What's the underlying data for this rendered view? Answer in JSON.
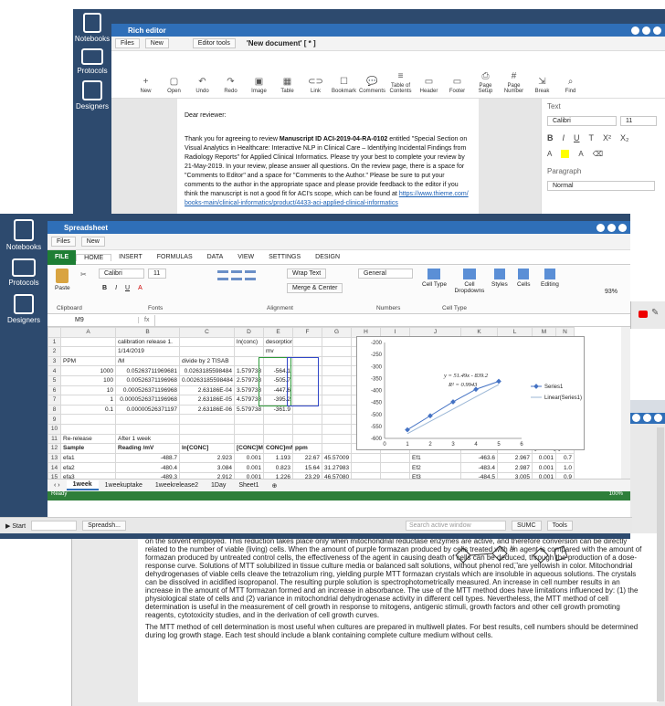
{
  "left_sidebar": {
    "items": [
      {
        "label": "Notebooks",
        "icon": "notebook-icon"
      },
      {
        "label": "Protocols",
        "icon": "protocols-icon"
      },
      {
        "label": "Designers",
        "icon": "designers-icon"
      }
    ]
  },
  "rich_editor": {
    "title": "Rich editor",
    "menu": {
      "files": "Files",
      "new": "New",
      "editor_tools": "Editor tools",
      "doc_name": "'New document' [ * ]"
    },
    "toolbar": [
      "New",
      "Open",
      "Undo",
      "Redo",
      "Image",
      "Table",
      "Link",
      "Bookmark",
      "Comments",
      "Table of Contents",
      "Header",
      "Footer",
      "Page Setup",
      "Page Number",
      "Break",
      "Find"
    ],
    "panel": {
      "text_label": "Text",
      "font": "Calibri",
      "size": "11",
      "paragraph_label": "Paragraph",
      "style": "Normal"
    },
    "document": {
      "greeting": "Dear reviewer:",
      "body_pre": "Thank you for agreeing to review ",
      "manuscript": "Manuscript ID ACI-2019-04-RA-0102",
      "body_post": " entitled \"Special Section on Visual Analytics in Healthcare: Interactive NLP in Clinical Care – Identifying Incidental Findings from Radiology Reports\" for Applied Clinical Informatics. Please try your best to complete your review by 21-May-2019. In your review, please answer all questions. On the review page, there is a space for \"Comments to Editor\" and a space for \"Comments to the Author.\" Please be sure to put your comments to the author in the appropriate space and please provide feedback to the editor if you think the manuscript is not a good fit for ACI's scope, which can be found at",
      "link": "https://www.thieme.com/books-main/clinical-informatics/product/4433-aci-applied-clinical-informatics"
    }
  },
  "spreadsheet": {
    "title": "Spreadsheet",
    "menu": {
      "files": "Files",
      "new": "New"
    },
    "tabs": [
      "FILE",
      "HOME",
      "INSERT",
      "FORMULAS",
      "DATA",
      "VIEW",
      "SETTINGS",
      "DESIGN"
    ],
    "ribbon": {
      "paste": "Paste",
      "font": "Calibri",
      "font_size": "11",
      "wrap_text": "Wrap Text",
      "merge_center": "Merge & Center",
      "number_format": "General",
      "cell_type": "Cell Type",
      "cell_dropdowns": "Cell Dropdowns",
      "styles": "Styles",
      "cells": "Cells",
      "editing": "Editing",
      "groups": [
        "Clipboard",
        "Fonts",
        "Alignment",
        "Numbers",
        "Cell Type"
      ],
      "zoom": "93%"
    },
    "name_box": "M9",
    "columns": [
      "A",
      "B",
      "C",
      "D",
      "E",
      "F",
      "G",
      "H",
      "I",
      "J",
      "K",
      "L",
      "M",
      "N"
    ],
    "rows": [
      {
        "n": "1",
        "cells": [
          "",
          "calibration release 1.",
          "",
          "ln(conc)",
          "desorption",
          "",
          "",
          "",
          "",
          "",
          "",
          "",
          "",
          ""
        ]
      },
      {
        "n": "2",
        "cells": [
          "",
          "1/14/2019",
          "",
          "",
          "mv",
          "",
          "",
          "",
          "",
          "",
          "",
          "",
          "",
          ""
        ]
      },
      {
        "n": "3",
        "cells": [
          "PPM",
          "/M",
          "divide by 2 TISAB",
          "",
          "",
          "",
          "",
          "",
          "",
          "",
          "",
          "",
          "",
          ""
        ]
      },
      {
        "n": "4",
        "cells": [
          "1000",
          "0.05263711969681",
          "0.0263185598484",
          "1.579738",
          "-564.1",
          "",
          "",
          "",
          "",
          "",
          "",
          "",
          "",
          ""
        ]
      },
      {
        "n": "5",
        "cells": [
          "100",
          "0.00526371196968",
          "0.00263185598484",
          "2.579738",
          "-505.7",
          "",
          "",
          "",
          "",
          "",
          "",
          "",
          "",
          ""
        ]
      },
      {
        "n": "6",
        "cells": [
          "10",
          "0.000526371196968",
          "2.63186E-04",
          "3.579738",
          "-447.6",
          "",
          "",
          "",
          "",
          "",
          "",
          "",
          "",
          ""
        ]
      },
      {
        "n": "7",
        "cells": [
          "1",
          "0.0000526371196968",
          "2.63186E-05",
          "4.579738",
          "-395.2",
          "",
          "",
          "",
          "",
          "",
          "",
          "",
          "",
          ""
        ]
      },
      {
        "n": "8",
        "cells": [
          "0.1",
          "0.00000526371197",
          "2.63186E-06",
          "5.579738",
          "-361.9",
          "",
          "",
          "",
          "",
          "",
          "",
          "",
          "",
          ""
        ]
      },
      {
        "n": "9",
        "cells": [
          "",
          "",
          "",
          "",
          "",
          "",
          "",
          "",
          "",
          "",
          "",
          "",
          "",
          ""
        ]
      },
      {
        "n": "10",
        "cells": [
          "",
          "",
          "",
          "",
          "",
          "",
          "",
          "",
          "",
          "",
          "",
          "",
          "",
          ""
        ]
      },
      {
        "n": "11",
        "cells": [
          "Re-release",
          "After 1 week",
          "",
          "",
          "",
          "",
          "",
          "",
          "",
          "",
          "",
          "",
          "",
          ""
        ]
      },
      {
        "n": "12",
        "cells": [
          "Sample",
          "Reading /mV",
          "ln[CONC]",
          "[CONC]M",
          "CONC]mM",
          "ppm",
          "",
          "",
          "",
          "",
          "",
          "",
          "[CONC]M",
          "[CONC"
        ]
      },
      {
        "n": "13",
        "cells": [
          "efa1",
          "-488.7",
          "2.923",
          "0.001",
          "1.193",
          "22.67",
          "45.57009",
          "",
          "",
          "Ef1",
          "-463.6",
          "2.967",
          "0.001",
          "0.7"
        ]
      },
      {
        "n": "14",
        "cells": [
          "efa2",
          "-480.4",
          "3.084",
          "0.001",
          "0.823",
          "15.64",
          "31.27983",
          "",
          "",
          "Ef2",
          "-483.4",
          "2.987",
          "0.001",
          "1.0"
        ]
      },
      {
        "n": "15",
        "cells": [
          "efa3",
          "-489.3",
          "2.912",
          "0.001",
          "1.226",
          "23.29",
          "46.57080",
          "",
          "",
          "Ef3",
          "-484.5",
          "3.005",
          "0.001",
          "0.9"
        ]
      }
    ],
    "sheet_tabs": [
      "1week",
      "1weekuptake",
      "1weekrelease2",
      "1Day",
      "Sheet1"
    ],
    "status": "Ready",
    "zoom_status": "100%"
  },
  "chart_data": {
    "type": "scatter",
    "x": [
      1,
      2,
      3,
      4,
      5
    ],
    "series": [
      {
        "name": "Series1",
        "values": [
          -564.1,
          -505.7,
          -447.6,
          -395.2,
          -361.9
        ]
      },
      {
        "name": "Linear(Series1)",
        "values": [
          -580.1,
          -528.9,
          -477.7,
          -426.5,
          -375.3
        ]
      }
    ],
    "annotations": [
      "y = 51.49x - 839.2",
      "R² = 0.9943"
    ],
    "xlim": [
      0,
      6
    ],
    "ylim": [
      -600,
      -200
    ],
    "x_ticks": [
      0,
      1,
      2,
      3,
      4,
      5,
      6
    ],
    "y_ticks": [
      -200,
      -250,
      -300,
      -350,
      -400,
      -450,
      -500,
      -550,
      -600
    ],
    "legend": "right",
    "grid": false
  },
  "taskbar": {
    "start": "Start",
    "spreadsheet_item": "Spreadsh...",
    "search_placeholder": "Search active window",
    "sumc": "SUMC",
    "tools": "Tools"
  },
  "pdf_viewer": {
    "paragraph1": "on the solvent employed. This reduction takes place only when mitochondrial reductase enzymes are active, and therefore conversion can be directly related to the number of viable (living) cells. When the amount of purple formazan produced by cells treated with an agent is compared with the amount of formazan produced by untreated control cells, the effectiveness of the agent in causing death of cells can be deduced, through the production of a dose-response curve. Solutions of MTT solubilized in tissue culture media or balanced salt solutions, without phenol red, are yellowish in color. Mitochondrial dehydrogenases of viable cells cleave the tetrazolium ring, yielding purple MTT formazan crystals which are insoluble in aqueous solutions. The crystals can be dissolved in acidified isopropanol. The resulting purple solution is spectrophotometrically measured. An increase in cell number results in an increase in the amount of MTT formazan formed and an increase in absorbance. The use of the MTT method does have limitations influenced by: (1) the physiological state of cells and (2) variance in mitochondrial dehydrogenase activity in different cell types. Nevertheless, the MTT method of cell determination is useful in the measurement of cell growth in response to mitogens, antigenic stimuli, growth factors and other cell growth promoting reagents, cytotoxicity studies, and in the derivation of cell growth curves.",
    "paragraph2": "The MTT method of cell determination is most useful when cultures are prepared in multiwell plates. For best results, cell numbers should be determined during log growth stage. Each test should include a blank containing complete culture medium without cells."
  }
}
